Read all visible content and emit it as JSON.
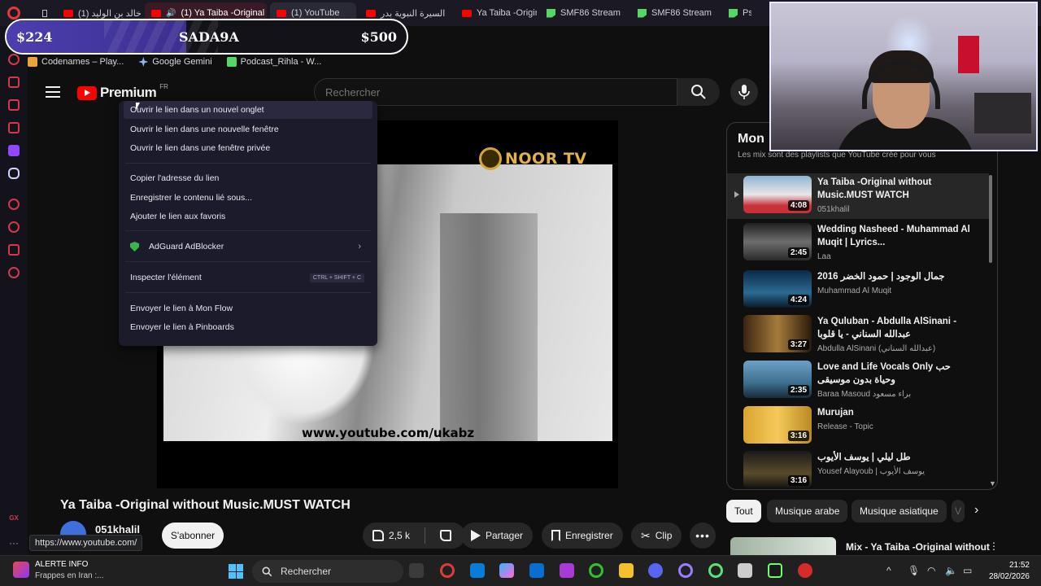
{
  "browser": {
    "tabs": [
      {
        "label": "(1) خالد بن الوليد",
        "favicon": "youtube-icon"
      },
      {
        "label": "(1) Ya Taiba -Original v",
        "favicon": "youtube-icon",
        "active": true
      },
      {
        "label": "(1) YouTube",
        "favicon": "youtube-icon"
      },
      {
        "label": "السيرة النبوية بدر",
        "favicon": "youtube-icon"
      },
      {
        "label": "Ya Taiba -Origin",
        "favicon": "youtube-icon"
      },
      {
        "label": "SMF86 Stream",
        "favicon": "twitch-icon"
      },
      {
        "label": "SMF86 Stream",
        "favicon": "twitch-icon"
      },
      {
        "label": "Ps",
        "favicon": "twitch-icon"
      }
    ],
    "bookmarks": [
      {
        "label": "Codenames – Play...",
        "color": "#e8a33d"
      },
      {
        "label": "Google Gemini",
        "color": "#8ab4f8"
      },
      {
        "label": "Podcast_Rihla - W...",
        "color": "#53d769"
      }
    ]
  },
  "donation": {
    "current": "$224",
    "name": "SADA9A",
    "goal": "$500",
    "progress": 0.45
  },
  "youtube": {
    "logo_text": "Premium",
    "region": "FR",
    "search_placeholder": "Rechercher",
    "video": {
      "channel_logo": "NOOR TV",
      "watermark": "www.youtube.com/ukabz",
      "title": "Ya Taiba -Original without Music.MUST WATCH",
      "channel": "051khalil",
      "subscribe": "S'abonner",
      "likes": "2,5 k",
      "share": "Partager",
      "save": "Enregistrer",
      "clip": "Clip"
    },
    "status_url": "https://www.youtube.com/"
  },
  "context_menu": {
    "items": [
      {
        "label": "Ouvrir le lien dans un nouvel onglet"
      },
      {
        "label": "Ouvrir le lien dans une nouvelle fenêtre"
      },
      {
        "label": "Ouvrir le lien dans une fenêtre privée"
      },
      {
        "label": "Copier l'adresse du lien"
      },
      {
        "label": "Enregistrer le contenu lié sous..."
      },
      {
        "label": "Ajouter le lien aux favoris"
      },
      {
        "label": "AdGuard AdBlocker"
      },
      {
        "label": "Inspecter l'élément",
        "shortcut": "CTRL + SHIFT + C"
      },
      {
        "label": "Envoyer le lien à Mon Flow"
      },
      {
        "label": "Envoyer le lien à Pinboards"
      }
    ]
  },
  "mix": {
    "title": "Mon",
    "subtitle": "Les mix sont des playlists que YouTube crée pour vous",
    "items": [
      {
        "title": "Ya Taiba -Original without Music.MUST WATCH",
        "author": "051khalil",
        "duration": "4:08"
      },
      {
        "title": "Wedding Nasheed - Muhammad Al Muqit | Lyrics...",
        "author": "Laa",
        "duration": "2:45"
      },
      {
        "title": "جمال الوجود | حمود الخضر 2016",
        "author": "Muhammad Al Muqit",
        "duration": "4:24"
      },
      {
        "title": "Ya Quluban - Abdulla AlSinani - عبدالله السناني - يا قلوبا",
        "author": "Abdulla AlSinani (عبدالله السناني)",
        "duration": "3:27"
      },
      {
        "title": "Love and Life Vocals Only حب وحياة بدون موسيقى",
        "author": "Baraa Masoud براء مسعود",
        "duration": "2:35"
      },
      {
        "title": "Murujan",
        "author": "Release - Topic",
        "duration": "3:16"
      },
      {
        "title": "طل ليلي | يوسف الأيوب",
        "author": "Yousef Alayoub | يوسف الأيوب",
        "duration": "3:16"
      }
    ],
    "chips": [
      "Tout",
      "Musique arabe",
      "Musique asiatique",
      "V"
    ],
    "next_title": "Mix - Ya Taiba -Original without"
  },
  "taskbar": {
    "news_title": "ALERTE INFO",
    "news_sub": "Frappes en Iran :...",
    "search": "Rechercher",
    "time": "21:52",
    "date": "28/02/2026"
  }
}
